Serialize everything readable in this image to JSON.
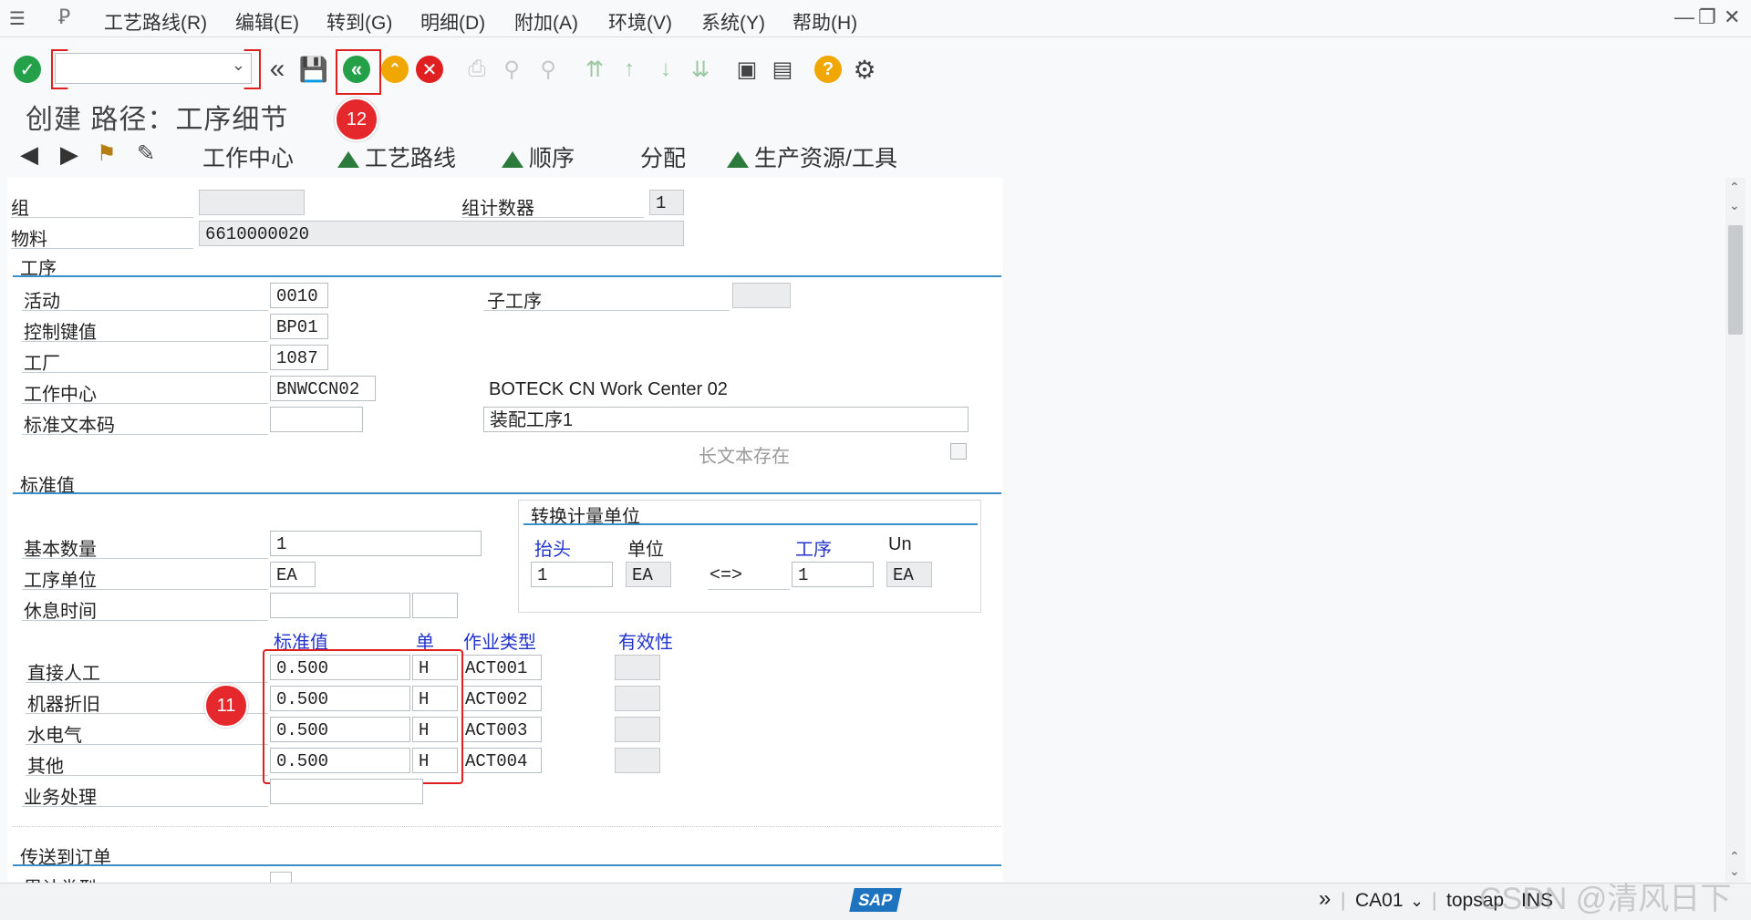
{
  "menu": {
    "items": [
      "工艺路线(R)",
      "编辑(E)",
      "转到(G)",
      "明细(D)",
      "附加(A)",
      "环境(V)",
      "系统(Y)",
      "帮助(H)"
    ]
  },
  "toolbar": {
    "command_value": "",
    "badge_12": "12"
  },
  "title": "创建 路径：工序细节",
  "app_toolbar": {
    "work_center": "工作中心",
    "routing": "工艺路线",
    "sequence": "顺序",
    "allocation": "分配",
    "prt": "生产资源/工具"
  },
  "header": {
    "group_label": "组",
    "group_value": "",
    "group_counter_label": "组计数器",
    "group_counter_value": "1",
    "material_label": "物料",
    "material_value": "6610000020"
  },
  "operation": {
    "section": "工序",
    "activity_label": "活动",
    "activity_value": "0010",
    "sub_op_label": "子工序",
    "sub_op_value": "",
    "control_key_label": "控制键值",
    "control_key_value": "BP01",
    "plant_label": "工厂",
    "plant_value": "1087",
    "work_center_label": "工作中心",
    "work_center_value": "BNWCCN02",
    "work_center_desc": "BOTECK CN Work Center 02",
    "std_text_label": "标准文本码",
    "std_text_value": "",
    "op_desc_value": "装配工序1",
    "long_text_label": "长文本存在"
  },
  "standard_values": {
    "section": "标准值",
    "base_qty_label": "基本数量",
    "base_qty_value": "1",
    "op_unit_label": "工序单位",
    "op_unit_value": "EA",
    "break_label": "休息时间",
    "break_value": "",
    "break_unit": "",
    "conversion": {
      "title": "转换计量单位",
      "header_col": "抬头",
      "unit_col": "单位",
      "op_col": "工序",
      "un_col": "Un",
      "header_value": "1",
      "header_unit": "EA",
      "arrow": "<=>",
      "op_value": "1",
      "op_unit": "EA"
    },
    "col_std": "标准值",
    "col_unit": "单",
    "col_acttype": "作业类型",
    "col_valid": "有效性",
    "badge_11": "11",
    "rows": [
      {
        "label": "直接人工",
        "value": "0.500",
        "unit": "H",
        "act": "ACT001"
      },
      {
        "label": "机器折旧",
        "value": "0.500",
        "unit": "H",
        "act": "ACT002"
      },
      {
        "label": "水电气",
        "value": "0.500",
        "unit": "H",
        "act": "ACT003"
      },
      {
        "label": "其他",
        "value": "0.500",
        "unit": "H",
        "act": "ACT004"
      }
    ],
    "business_process_label": "业务处理",
    "business_process_value": ""
  },
  "transfer": {
    "section": "传送到订单",
    "cost_type_label": "累计类型"
  },
  "status": {
    "system": "CA01",
    "server": "topsap",
    "mode": "INS",
    "sap_logo": "SAP",
    "watermark": "CSDN @清风日下"
  }
}
